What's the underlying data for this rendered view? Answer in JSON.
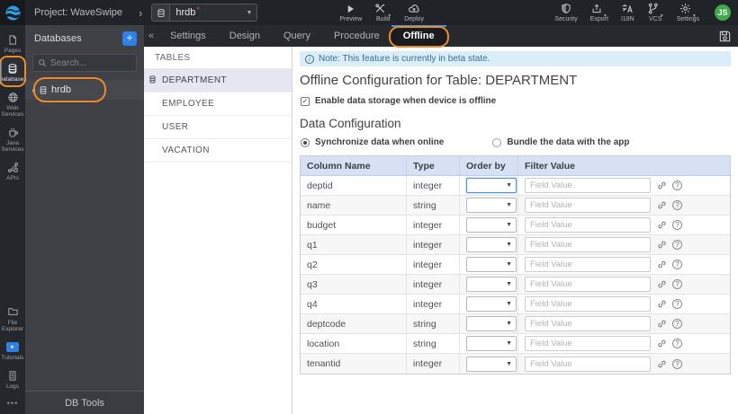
{
  "topbar": {
    "project": "Project: WaveSwipe",
    "db_selector": {
      "value": "hrdb",
      "modified_mark": "*"
    },
    "actions": [
      {
        "label": "Preview",
        "icon": "play-icon"
      },
      {
        "label": "Build",
        "icon": "build-icon"
      },
      {
        "label": "Deploy",
        "icon": "deploy-cloud-icon"
      }
    ],
    "utilities": [
      {
        "label": "Security",
        "icon": "shield-icon"
      },
      {
        "label": "Export",
        "icon": "export-icon"
      },
      {
        "label": "I18N",
        "icon": "i18n-icon"
      },
      {
        "label": "VCS",
        "icon": "vcs-branch-icon"
      },
      {
        "label": "Settings",
        "icon": "gear-icon"
      }
    ],
    "avatar": "JS"
  },
  "sidebar": {
    "items": [
      {
        "label": "Pages",
        "icon": "pages-icon"
      },
      {
        "label": "Databases",
        "icon": "database-icon",
        "active": true
      },
      {
        "label": "Web Services",
        "icon": "globe-icon"
      },
      {
        "label": "Java Services",
        "icon": "coffee-icon"
      },
      {
        "label": "APIs",
        "icon": "api-icon"
      }
    ],
    "bottom_items": [
      {
        "label": "File Explorer",
        "icon": "folder-icon"
      },
      {
        "label": "Tutorials",
        "icon": "video-icon"
      },
      {
        "label": "Logs",
        "icon": "logs-icon"
      }
    ]
  },
  "db_panel": {
    "title": "Databases",
    "add_label": "+",
    "search_placeholder": "Search...",
    "items": [
      {
        "name": "hrdb"
      }
    ],
    "footer": "DB Tools"
  },
  "tabs": {
    "items": [
      "Settings",
      "Design",
      "Query",
      "Procedure",
      "Offline"
    ],
    "active": "Offline"
  },
  "tables_panel": {
    "header": "TABLES",
    "items": [
      "DEPARTMENT",
      "EMPLOYEE",
      "USER",
      "VACATION"
    ],
    "selected": "DEPARTMENT"
  },
  "content": {
    "note": "Note: This feature is currently in beta state.",
    "title": "Offline Configuration for Table: DEPARTMENT",
    "checkbox_label": "Enable data storage when device is offline",
    "checkbox_checked": true,
    "section_title": "Data Configuration",
    "radio_options": [
      {
        "label": "Synchronize data when online",
        "selected": true
      },
      {
        "label": "Bundle the data with the app",
        "selected": false
      }
    ],
    "table": {
      "headers": [
        "Column Name",
        "Type",
        "Order by",
        "Filter Value"
      ],
      "field_placeholder": "Field Value",
      "rows": [
        {
          "name": "deptid",
          "type": "integer"
        },
        {
          "name": "name",
          "type": "string"
        },
        {
          "name": "budget",
          "type": "integer"
        },
        {
          "name": "q1",
          "type": "integer"
        },
        {
          "name": "q2",
          "type": "integer"
        },
        {
          "name": "q3",
          "type": "integer"
        },
        {
          "name": "q4",
          "type": "integer"
        },
        {
          "name": "deptcode",
          "type": "string"
        },
        {
          "name": "location",
          "type": "string"
        },
        {
          "name": "tenantid",
          "type": "integer"
        }
      ]
    }
  },
  "colors": {
    "accent_orange": "#ec8b2a",
    "accent_blue": "#2f80e7",
    "avatar_green": "#3fa94c",
    "note_bg": "#daedf8",
    "note_fg": "#31708f",
    "table_head_bg": "#d8e1f3"
  }
}
